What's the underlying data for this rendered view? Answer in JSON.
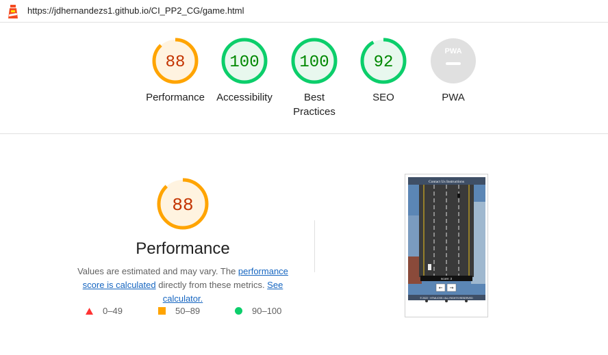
{
  "header": {
    "url": "https://jdhernandezs1.github.io/CI_PP2_CG/game.html",
    "logo_icon": "lighthouse-icon"
  },
  "categories": [
    {
      "id": "performance",
      "label": "Performance",
      "score": "88",
      "level": 0.88,
      "status": "average"
    },
    {
      "id": "accessibility",
      "label": "Accessibility",
      "score": "100",
      "level": 1.0,
      "status": "pass"
    },
    {
      "id": "best-practices",
      "label": "Best Practices",
      "score": "100",
      "level": 1.0,
      "status": "pass"
    },
    {
      "id": "seo",
      "label": "SEO",
      "score": "92",
      "level": 0.92,
      "status": "pass"
    },
    {
      "id": "pwa",
      "label": "PWA",
      "badge": "PWA",
      "status": "na"
    }
  ],
  "performance_section": {
    "score": "88",
    "level": 0.88,
    "title": "Performance",
    "desc_prefix": "Values are estimated and may vary. The ",
    "link_score": "performance score is calculated",
    "desc_middle": " directly from these metrics. ",
    "link_calc": "See calculator.",
    "legend": [
      {
        "shape": "triangle",
        "range": "0–49",
        "color": "#ff3333"
      },
      {
        "shape": "square",
        "range": "50–89",
        "color": "#ffa400"
      },
      {
        "shape": "circle",
        "range": "90–100",
        "color": "#0cce6b"
      }
    ]
  },
  "thumbnail": {
    "nav_text": "Contact Us  Instructions",
    "score_text": "score: 3",
    "footer_text": "© 2022 · HTML/CSS / ALL RIGHTS RESERVED"
  },
  "colors": {
    "average_stroke": "#ffa400",
    "average_fill": "#fff3e0",
    "average_text": "#c33300",
    "pass_stroke": "#0cce6b",
    "pass_fill": "#e8f8ee",
    "pass_text": "#008800",
    "na_fill": "#e0e0e0"
  }
}
